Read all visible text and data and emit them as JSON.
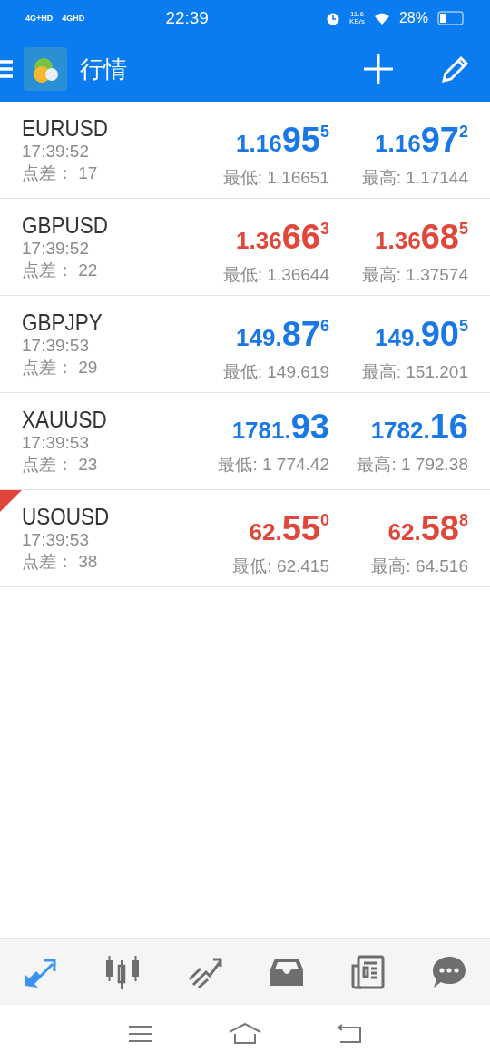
{
  "status_bar": {
    "network": [
      "4G+HD",
      "4GHD"
    ],
    "time": "22:39",
    "speed": "11.6",
    "speed_unit": "KB/s",
    "battery": "28%"
  },
  "app_bar": {
    "title": "行情"
  },
  "quotes": [
    {
      "symbol": "EURUSD",
      "time": "17:39:52",
      "spread_label": "点差：",
      "spread": "17",
      "color": "#1a78e6",
      "flagged": false,
      "bid": {
        "prefix": "1.16",
        "big": "95",
        "sup": "5"
      },
      "ask": {
        "prefix": "1.16",
        "big": "97",
        "sup": "2"
      },
      "low": "最低: 1.16651",
      "high": "最高: 1.17144"
    },
    {
      "symbol": "GBPUSD",
      "time": "17:39:52",
      "spread_label": "点差：",
      "spread": "22",
      "color": "#e0463a",
      "flagged": false,
      "bid": {
        "prefix": "1.36",
        "big": "66",
        "sup": "3"
      },
      "ask": {
        "prefix": "1.36",
        "big": "68",
        "sup": "5"
      },
      "low": "最低: 1.36644",
      "high": "最高: 1.37574"
    },
    {
      "symbol": "GBPJPY",
      "time": "17:39:53",
      "spread_label": "点差：",
      "spread": "29",
      "color": "#1a78e6",
      "flagged": false,
      "bid": {
        "prefix": "149.",
        "big": "87",
        "sup": "6"
      },
      "ask": {
        "prefix": "149.",
        "big": "90",
        "sup": "5"
      },
      "low": "最低: 149.619",
      "high": "最高: 151.201"
    },
    {
      "symbol": "XAUUSD",
      "time": "17:39:53",
      "spread_label": "点差：",
      "spread": "23",
      "color": "#1a78e6",
      "flagged": false,
      "bid": {
        "prefix": "1781.",
        "big": "93"
      },
      "ask": {
        "prefix": "1782.",
        "big": "16"
      },
      "low": "最低: 1 774.42",
      "high": "最高: 1 792.38"
    },
    {
      "symbol": "USOUSD",
      "time": "17:39:53",
      "spread_label": "点差：",
      "spread": "38",
      "color": "#e0463a",
      "flagged": true,
      "bid": {
        "prefix": "62.",
        "big": "55",
        "sup": "0"
      },
      "ask": {
        "prefix": "62.",
        "big": "58",
        "sup": "8"
      },
      "low": "最低: 62.415",
      "high": "最高: 64.516"
    }
  ],
  "bottom_tabs": [
    {
      "kind": "quotes",
      "selected": true
    },
    {
      "kind": "chart",
      "selected": false
    },
    {
      "kind": "trade",
      "selected": false
    },
    {
      "kind": "history",
      "selected": false
    },
    {
      "kind": "news",
      "selected": false
    },
    {
      "kind": "chat",
      "selected": false
    }
  ]
}
